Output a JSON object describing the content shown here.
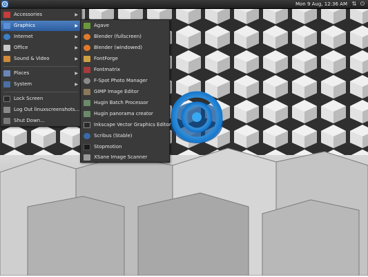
{
  "clock": "Mon  9 Aug, 12:36 AM",
  "colors": {
    "menu_bg": "#3a3a3a",
    "selection": "#3b6fb3",
    "panel": "#262626"
  },
  "main_menu": {
    "items": [
      {
        "label": "Accessories",
        "icon": "accessories-icon",
        "color": "#c83c3c",
        "submenu": true
      },
      {
        "label": "Graphics",
        "icon": "graphics-icon",
        "color": "#5b8fd6",
        "submenu": true,
        "selected": true
      },
      {
        "label": "Internet",
        "icon": "internet-icon",
        "color": "#3c7fc8",
        "submenu": true
      },
      {
        "label": "Office",
        "icon": "office-icon",
        "color": "#c8c8c8",
        "submenu": true
      },
      {
        "label": "Sound & Video",
        "icon": "sound-video-icon",
        "color": "#d08a3a",
        "submenu": true
      },
      {
        "label": "Places",
        "icon": "places-icon",
        "color": "#6a86b8",
        "submenu": true
      },
      {
        "label": "System",
        "icon": "system-icon",
        "color": "#4a6fa0",
        "submenu": true
      },
      {
        "label": "Lock Screen",
        "icon": "lock-screen-icon",
        "color": "#2a2a2a",
        "submenu": false
      },
      {
        "label": "Log Out linuxscreenshots...",
        "icon": "log-out-icon",
        "color": "#8a8a8a",
        "submenu": false
      },
      {
        "label": "Shut Down...",
        "icon": "shut-down-icon",
        "color": "#7a7a7a",
        "submenu": false
      }
    ]
  },
  "graphics_menu": {
    "items": [
      {
        "label": "Agave",
        "icon": "agave-icon",
        "color": "#6a9a3a"
      },
      {
        "label": "Blender (fullscreen)",
        "icon": "blender-icon",
        "color": "#e07a2a"
      },
      {
        "label": "Blender (windowed)",
        "icon": "blender-icon",
        "color": "#e07a2a"
      },
      {
        "label": "FontForge",
        "icon": "fontforge-icon",
        "color": "#d0a040"
      },
      {
        "label": "Fontmatrix",
        "icon": "fontmatrix-icon",
        "color": "#a83a3a"
      },
      {
        "label": "F-Spot Photo Manager",
        "icon": "f-spot-icon",
        "color": "#8a8a8a"
      },
      {
        "label": "GIMP Image Editor",
        "icon": "gimp-icon",
        "color": "#8a7a5a"
      },
      {
        "label": "Hugin Batch Processor",
        "icon": "hugin-icon",
        "color": "#6a8a6a"
      },
      {
        "label": "Hugin panorama creator",
        "icon": "hugin-icon",
        "color": "#6a8a6a"
      },
      {
        "label": "Inkscape Vector Graphics Editor",
        "icon": "inkscape-icon",
        "color": "#2a2a2a"
      },
      {
        "label": "Scribus (Stable)",
        "icon": "scribus-icon",
        "color": "#3a6aa8"
      },
      {
        "label": "Stopmotion",
        "icon": "stopmotion-icon",
        "color": "#1a1a1a"
      },
      {
        "label": "XSane Image Scanner",
        "icon": "xsane-icon",
        "color": "#9a9a9a"
      }
    ]
  }
}
